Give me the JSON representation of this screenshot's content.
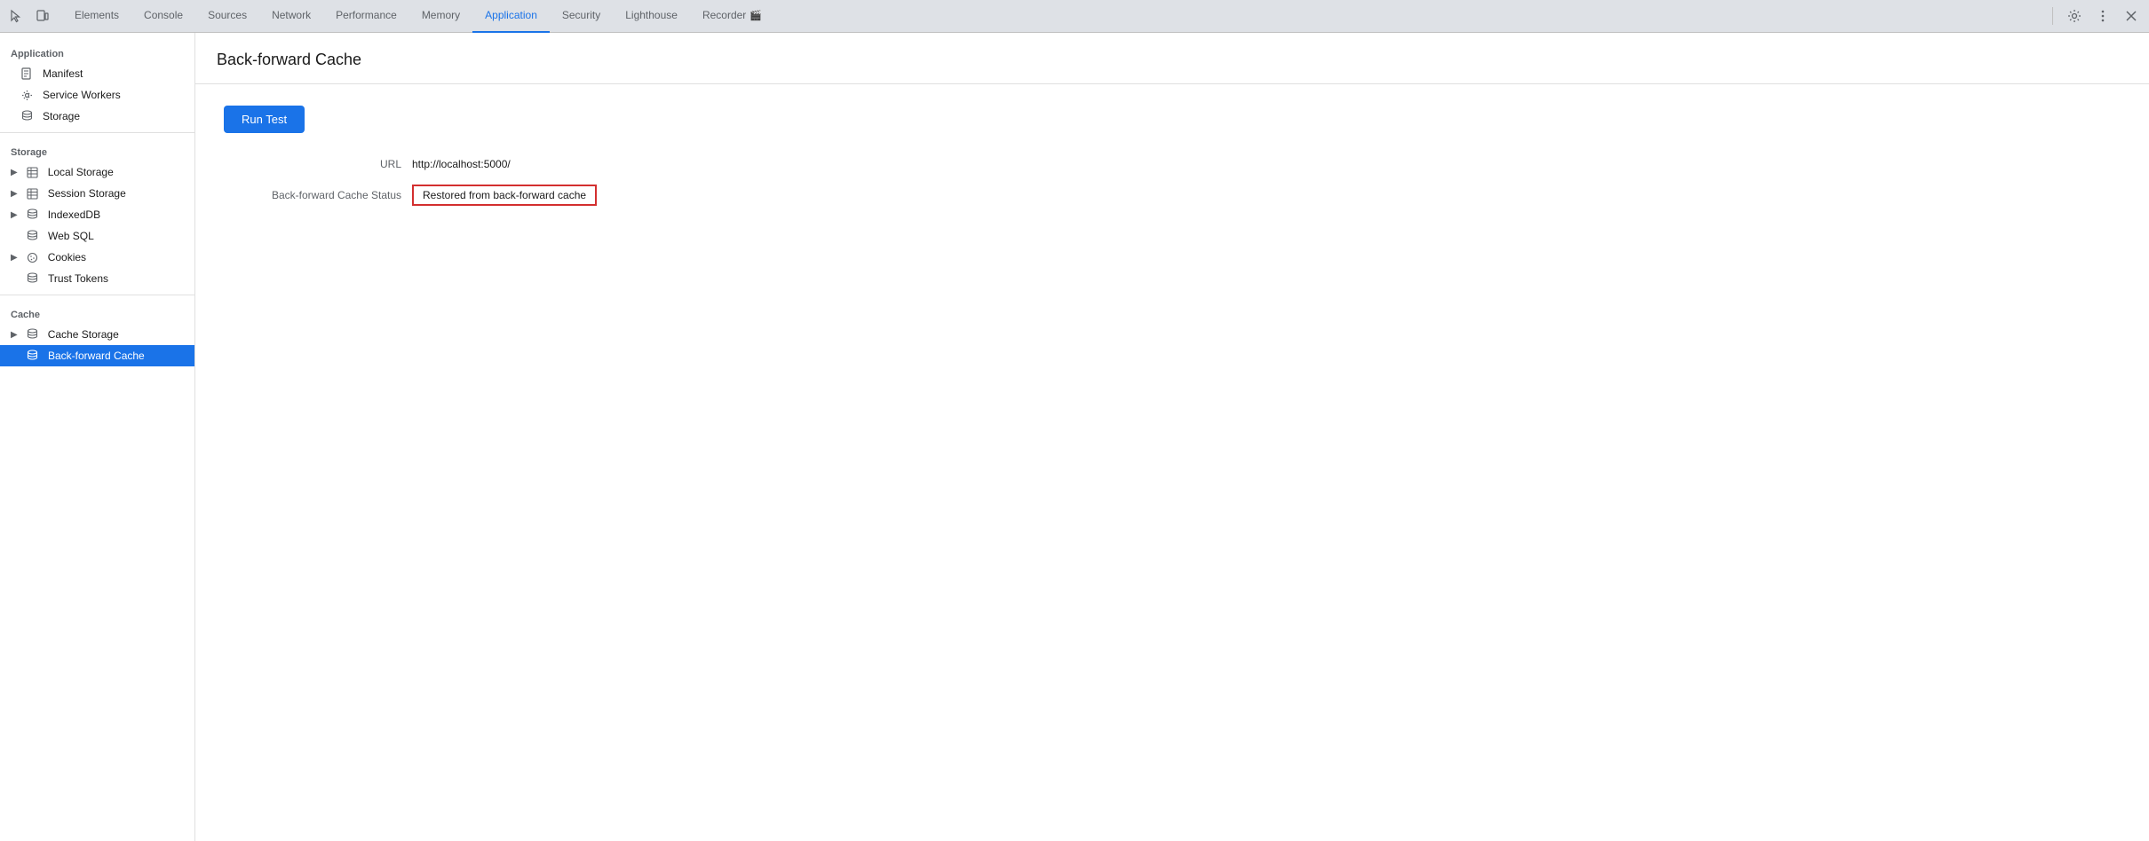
{
  "tabbar": {
    "tabs": [
      {
        "id": "elements",
        "label": "Elements",
        "active": false
      },
      {
        "id": "console",
        "label": "Console",
        "active": false
      },
      {
        "id": "sources",
        "label": "Sources",
        "active": false
      },
      {
        "id": "network",
        "label": "Network",
        "active": false
      },
      {
        "id": "performance",
        "label": "Performance",
        "active": false
      },
      {
        "id": "memory",
        "label": "Memory",
        "active": false
      },
      {
        "id": "application",
        "label": "Application",
        "active": true
      },
      {
        "id": "security",
        "label": "Security",
        "active": false
      },
      {
        "id": "lighthouse",
        "label": "Lighthouse",
        "active": false
      },
      {
        "id": "recorder",
        "label": "Recorder",
        "active": false
      }
    ]
  },
  "sidebar": {
    "application_section": "Application",
    "items_application": [
      {
        "id": "manifest",
        "label": "Manifest",
        "icon": "file"
      },
      {
        "id": "service-workers",
        "label": "Service Workers",
        "icon": "gear"
      },
      {
        "id": "storage",
        "label": "Storage",
        "icon": "database"
      }
    ],
    "storage_section": "Storage",
    "items_storage": [
      {
        "id": "local-storage",
        "label": "Local Storage",
        "icon": "table",
        "expandable": true
      },
      {
        "id": "session-storage",
        "label": "Session Storage",
        "icon": "table",
        "expandable": true
      },
      {
        "id": "indexeddb",
        "label": "IndexedDB",
        "icon": "database",
        "expandable": true
      },
      {
        "id": "web-sql",
        "label": "Web SQL",
        "icon": "database"
      },
      {
        "id": "cookies",
        "label": "Cookies",
        "icon": "cookie",
        "expandable": true
      },
      {
        "id": "trust-tokens",
        "label": "Trust Tokens",
        "icon": "database"
      }
    ],
    "cache_section": "Cache",
    "items_cache": [
      {
        "id": "cache-storage",
        "label": "Cache Storage",
        "icon": "database",
        "expandable": true
      },
      {
        "id": "back-forward-cache",
        "label": "Back-forward Cache",
        "icon": "database",
        "active": true
      }
    ]
  },
  "content": {
    "title": "Back-forward Cache",
    "run_test_label": "Run Test",
    "url_label": "URL",
    "url_value": "http://localhost:5000/",
    "cache_status_label": "Back-forward Cache Status",
    "cache_status_value": "Restored from back-forward cache"
  }
}
